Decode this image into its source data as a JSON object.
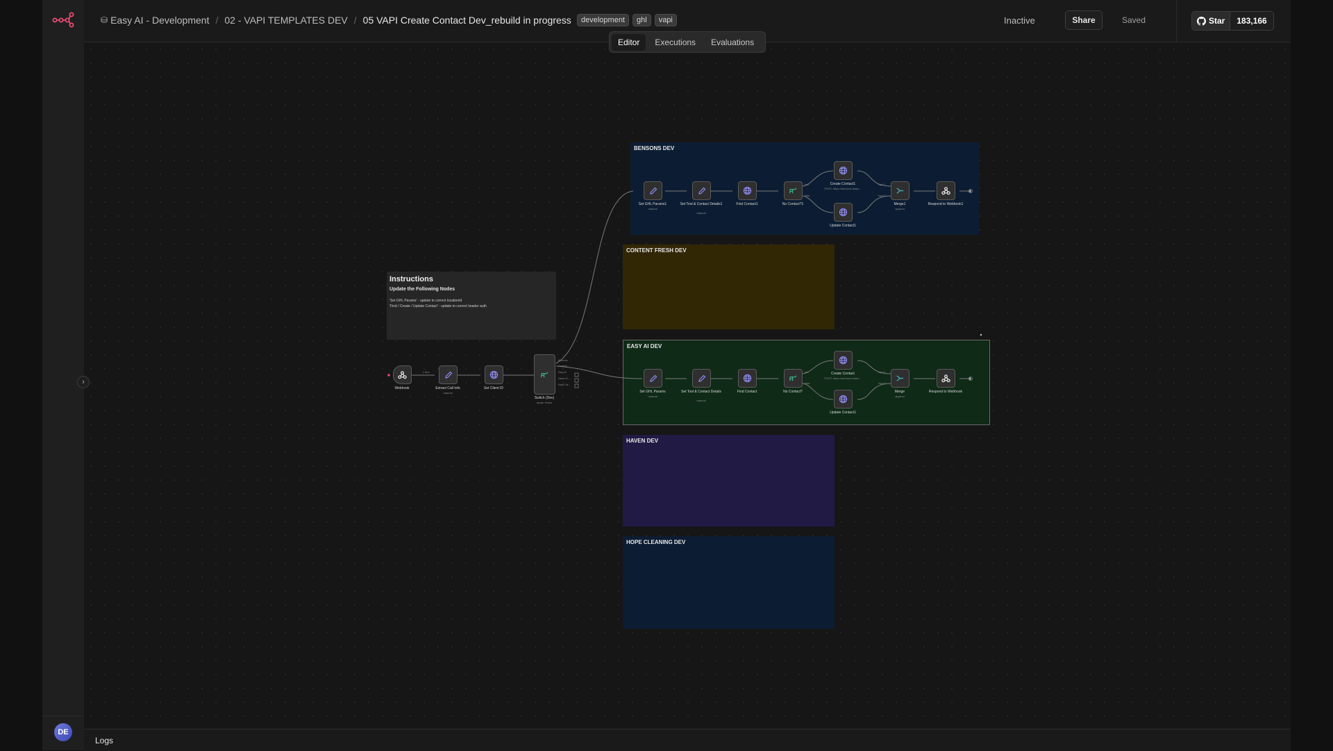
{
  "app": {
    "breadcrumb": {
      "project": "Easy AI - Development",
      "folder": "02 - VAPI TEMPLATES DEV",
      "workflow": "05 VAPI Create Contact Dev_rebuild in progress"
    },
    "tags": [
      "development",
      "ghl",
      "vapi"
    ],
    "status": "Inactive",
    "share_label": "Share",
    "saved_label": "Saved",
    "github": {
      "star_label": "Star",
      "star_count": "183,166"
    },
    "tabs": [
      {
        "label": "Editor",
        "active": true
      },
      {
        "label": "Executions",
        "active": false
      },
      {
        "label": "Evaluations",
        "active": false
      }
    ],
    "user_initials": "DE",
    "logs_label": "Logs",
    "accent_color": "#ea4b71"
  },
  "canvas": {
    "instructions": {
      "title": "Instructions",
      "subtitle": "Update the Following Nodes",
      "line1": "'Set GHL Params' - update to correct locationId",
      "line2": "'Find / Create / Update Contact' - update to correct header auth"
    },
    "stickies": {
      "bensons": {
        "title": "BENSONS DEV",
        "color": "#0c1d33"
      },
      "content_fresh": {
        "title": "CONTENT FRESH DEV",
        "color": "#322705"
      },
      "easy_ai": {
        "title": "EASY AI DEV",
        "color": "#0f2a17"
      },
      "haven": {
        "title": "HAVEN DEV",
        "color": "#211a44"
      },
      "hope_cleaning": {
        "title": "HOPE CLEANING DEV",
        "color": "#0c1c33"
      }
    },
    "main_flow": {
      "webhook": {
        "label": "Webhook",
        "icon": "webhook-icon"
      },
      "webhook_badge": "1 item",
      "extract": {
        "label": "Extract Call Info",
        "sub": "manual",
        "icon": "pencil-icon"
      },
      "set_client": {
        "label": "Set Client ID",
        "icon": "globe-icon"
      },
      "switch": {
        "label": "Switch (Dev)",
        "sub": "mode: Rules",
        "icon": "switch-icon"
      },
      "switch_outputs": [
        "Bensons",
        "Content...",
        "Easy AI",
        "Haven D...",
        "Hope Cle..."
      ]
    },
    "bensons_flow": {
      "set_ghl": {
        "label": "Set GHL Params1",
        "sub": "manual"
      },
      "set_tool": {
        "label": "Set Tool & Contact Details1",
        "sub": "manual"
      },
      "find": {
        "label": "Find Contact1"
      },
      "no_contact": {
        "label": "No Contact?1"
      },
      "create": {
        "label": "Create Contact1",
        "sub": "POST: https://services.leadc..."
      },
      "update": {
        "label": "Update Contact1"
      },
      "merge": {
        "label": "Merge1",
        "sub": "append"
      },
      "respond": {
        "label": "Respond to Webhook1"
      }
    },
    "easy_flow": {
      "set_ghl": {
        "label": "Set GHL Params",
        "sub": "manual"
      },
      "set_tool": {
        "label": "Set Tool & Contact Details",
        "sub": "manual"
      },
      "find": {
        "label": "Find Contact"
      },
      "no_contact": {
        "label": "No Contact?"
      },
      "create": {
        "label": "Create Contact",
        "sub": "POST: https://services.leadc..."
      },
      "update": {
        "label": "Update Contact1"
      },
      "merge": {
        "label": "Merge",
        "sub": "append"
      },
      "respond": {
        "label": "Respond to Webhook"
      }
    },
    "if_port_labels": {
      "true": "true",
      "false": "false"
    },
    "merge_port_labels": {
      "in1": "Input 1",
      "in2": "Input 2"
    }
  }
}
